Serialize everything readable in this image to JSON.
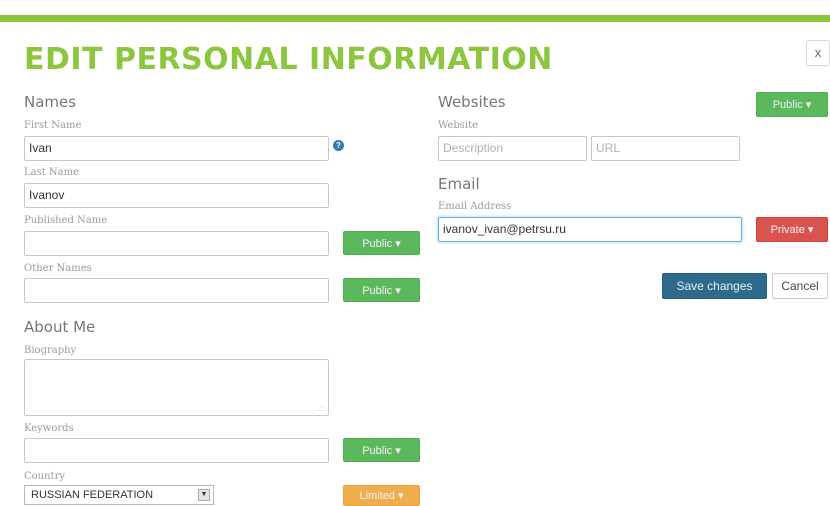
{
  "header": {
    "title": "EDIT PERSONAL INFORMATION",
    "close_label": "x",
    "accent_color": "#8cc63f"
  },
  "names": {
    "heading": "Names",
    "first_name": {
      "label": "First Name",
      "value": "Ivan"
    },
    "last_name": {
      "label": "Last Name",
      "value": "Ivanov"
    },
    "published_name": {
      "label": "Published Name",
      "value": "",
      "privacy": "Public ▾"
    },
    "other_names": {
      "label": "Other Names",
      "value": "",
      "privacy": "Public ▾"
    },
    "help_icon": "?"
  },
  "about_me": {
    "heading": "About Me",
    "biography": {
      "label": "Biography",
      "value": ""
    },
    "keywords": {
      "label": "Keywords",
      "value": "",
      "privacy": "Public ▾"
    },
    "country": {
      "label": "Country",
      "value": "RUSSIAN FEDERATION",
      "privacy": "Limited ▾"
    }
  },
  "websites": {
    "heading": "Websites",
    "privacy": "Public ▾",
    "label": "Website",
    "description_placeholder": "Description",
    "url_placeholder": "URL"
  },
  "email": {
    "heading": "Email",
    "label": "Email Address",
    "value": "ivanov_ivan@petrsu.ru",
    "privacy": "Private ▾"
  },
  "actions": {
    "save_label": "Save changes",
    "cancel_label": "Cancel"
  },
  "colors": {
    "public": "#5cb85c",
    "private": "#d9534f",
    "limited": "#f0ad4e",
    "save": "#2d6b8c"
  }
}
